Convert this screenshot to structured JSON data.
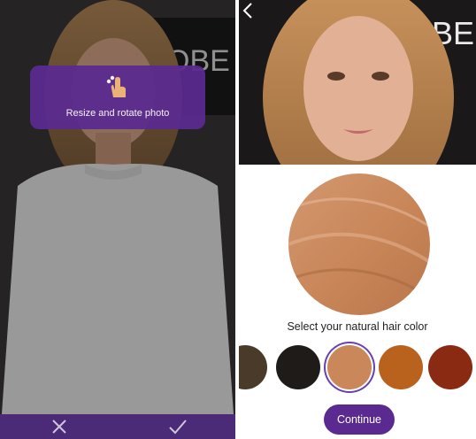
{
  "left_screen": {
    "tooltip_text": "Resize and rotate photo",
    "cancel_icon": "close-icon",
    "confirm_icon": "check-icon"
  },
  "right_screen": {
    "back_icon": "back-arrow-icon",
    "selected_color": "#c9875a",
    "prompt": "Select your natural hair color",
    "swatches": [
      {
        "color": "#4a3a2a"
      },
      {
        "color": "#1e1b18"
      },
      {
        "color": "#c9875a",
        "selected": true
      },
      {
        "color": "#b8621e"
      },
      {
        "color": "#8a2a12"
      }
    ],
    "continue_label": "Continue"
  },
  "colors": {
    "accent": "#5b2a91",
    "bottom_bar": "#4b2a78"
  }
}
